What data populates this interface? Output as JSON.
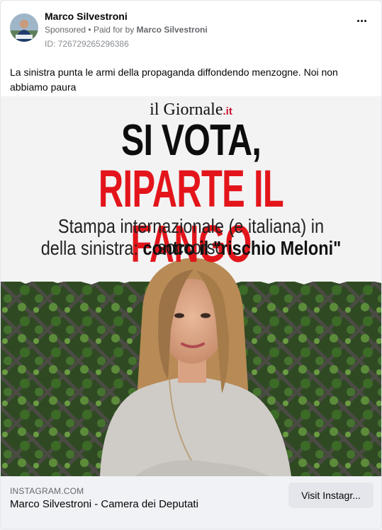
{
  "advertiser": {
    "name": "Marco Silvestroni",
    "sponsored_label": "Sponsored",
    "paid_for_prefix": "Paid for by",
    "paid_for_by": "Marco Silvestroni",
    "ad_id": "ID: 726729265296386"
  },
  "post": {
    "text": "La sinistra punta le armi della propaganda diffondendo menzogne. Noi non abbiamo paura"
  },
  "creative": {
    "logo_main": "il Giornale",
    "logo_suffix": ".it",
    "headline_black": "SI VOTA,",
    "headline_red": "RIPARTE IL FANGO",
    "subline_1": "Stampa internazionale (e italiana) in soccorso",
    "subline_2_regular": "della sinistra:",
    "subline_2_bold": "contro il \"rischio Meloni\""
  },
  "link": {
    "domain": "INSTAGRAM.COM",
    "title": "Marco Silvestroni - Camera dei Deputati",
    "cta_label": "Visit Instagr..."
  },
  "colors": {
    "headline_red": "#e3151b",
    "footer_bg": "#f0f2f5",
    "cta_bg": "#e4e6eb"
  }
}
